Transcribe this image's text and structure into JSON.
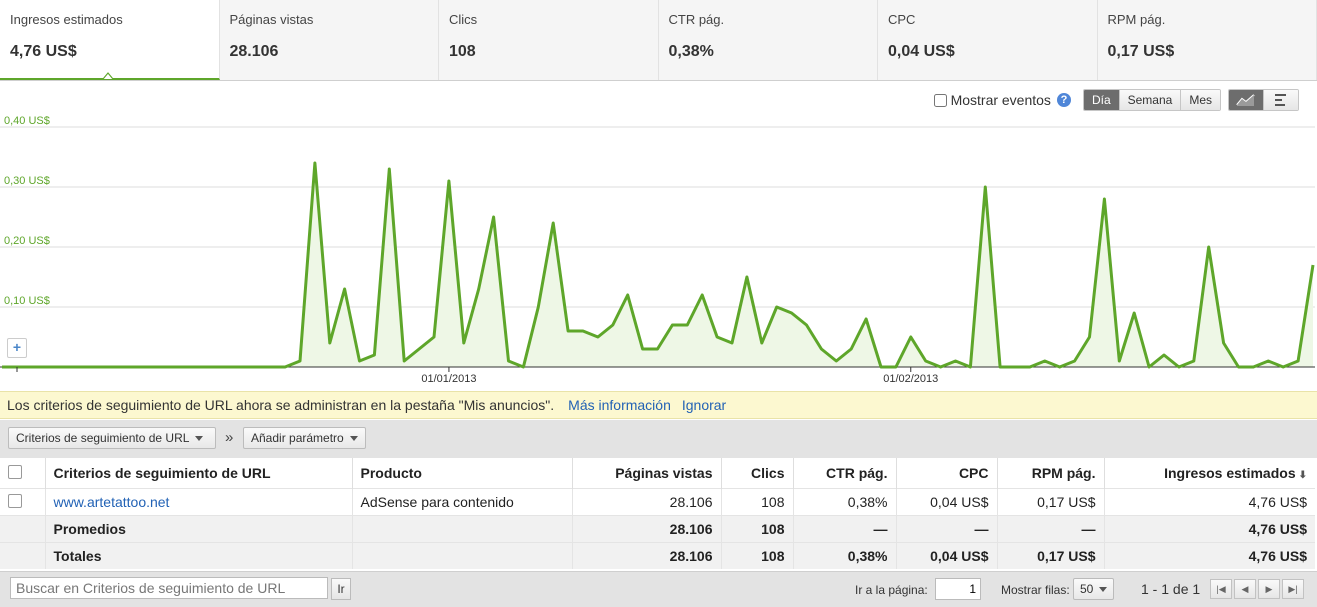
{
  "tabs": [
    {
      "label": "Ingresos estimados",
      "value": "4,76 US$",
      "active": true
    },
    {
      "label": "Páginas vistas",
      "value": "28.106"
    },
    {
      "label": "Clics",
      "value": "108"
    },
    {
      "label": "CTR pág.",
      "value": "0,38%"
    },
    {
      "label": "CPC",
      "value": "0,04 US$"
    },
    {
      "label": "RPM pág.",
      "value": "0,17 US$"
    }
  ],
  "controls": {
    "events_label": "Mostrar eventos",
    "help_glyph": "?",
    "granularity": [
      "Día",
      "Semana",
      "Mes"
    ],
    "granularity_selected": "Día",
    "view_icons": [
      "line-chart-icon",
      "bar-chart-icon"
    ]
  },
  "chart_data": {
    "type": "area",
    "series": [
      {
        "values": [
          0,
          0,
          0,
          0,
          0,
          0,
          0,
          0,
          0,
          0,
          0,
          0,
          0,
          0,
          0,
          0,
          0,
          0,
          0,
          0,
          0.01,
          0.34,
          0.04,
          0.13,
          0.01,
          0.02,
          0.33,
          0.01,
          0.03,
          0.05,
          0.31,
          0.04,
          0.13,
          0.25,
          0.01,
          0,
          0.1,
          0.24,
          0.06,
          0.06,
          0.05,
          0.07,
          0.12,
          0.03,
          0.03,
          0.07,
          0.07,
          0.12,
          0.05,
          0.04,
          0.15,
          0.04,
          0.1,
          0.09,
          0.07,
          0.03,
          0.01,
          0.03,
          0.08,
          0,
          0,
          0.05,
          0.01,
          0,
          0.01,
          0,
          0.3,
          0,
          0,
          0,
          0.01,
          0,
          0.01,
          0.05,
          0.28,
          0.01,
          0.09,
          0,
          0.02,
          0,
          0.01,
          0.2,
          0.04,
          0,
          0,
          0.01,
          0,
          0.01,
          0.17
        ]
      }
    ],
    "y_ticks": [
      "0,40 US$",
      "0,30 US$",
      "0,20 US$",
      "0,10 US$"
    ],
    "y_tick_values": [
      0.4,
      0.3,
      0.2,
      0.1
    ],
    "ylim": [
      0,
      0.4
    ],
    "x_labels": [
      {
        "label": "01/01/2013",
        "index": 30
      },
      {
        "label": "01/02/2013",
        "index": 61
      }
    ],
    "line_color": "#5ea62a",
    "fill_color": "#eef7e6",
    "grid": true
  },
  "notice": {
    "text": "Los criterios de seguimiento de URL ahora se administran en la pestaña \"Mis anuncios\".",
    "link_more": "Más información",
    "link_ignore": "Ignorar"
  },
  "filters": {
    "dimension": "Criterios de seguimiento de URL",
    "separator": "»",
    "add_param": "Añadir parámetro"
  },
  "table": {
    "headers": [
      "Criterios de seguimiento de URL",
      "Producto",
      "Páginas vistas",
      "Clics",
      "CTR pág.",
      "CPC",
      "RPM pág.",
      "Ingresos estimados"
    ],
    "sort_glyph": "⬇",
    "rows": [
      {
        "name": "www.artetattoo.net",
        "product": "AdSense para contenido",
        "pageviews": "28.106",
        "clicks": "108",
        "ctr": "0,38%",
        "cpc": "0,04 US$",
        "rpm": "0,17 US$",
        "revenue": "4,76 US$"
      }
    ],
    "averages": {
      "label": "Promedios",
      "pageviews": "28.106",
      "clicks": "108",
      "ctr": "—",
      "cpc": "—",
      "rpm": "—",
      "revenue": "4,76 US$"
    },
    "totals": {
      "label": "Totales",
      "pageviews": "28.106",
      "clicks": "108",
      "ctr": "0,38%",
      "cpc": "0,04 US$",
      "rpm": "0,17 US$",
      "revenue": "4,76 US$"
    }
  },
  "footer": {
    "search_placeholder": "Buscar en Criterios de seguimiento de URL",
    "go": "Ir",
    "page_label": "Ir a la página:",
    "page_value": "1",
    "rows_label": "Mostrar filas:",
    "rows_value": "50",
    "range": "1 - 1 de 1"
  }
}
